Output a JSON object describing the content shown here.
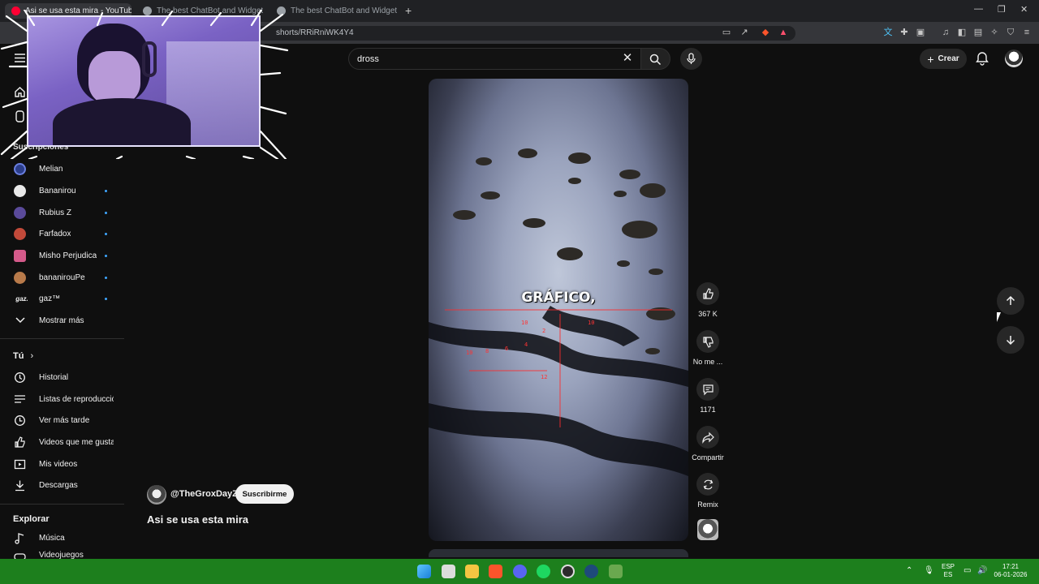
{
  "browser": {
    "tabs": [
      {
        "label": "Asi se usa esta mira - YouTube",
        "favicon_color": "#ff0033"
      },
      {
        "label": "The best ChatBot and Widgets for K",
        "favicon_color": "#9aa0a6"
      },
      {
        "label": "The best ChatBot and Widgets for Ki",
        "favicon_color": "#9aa0a6"
      }
    ],
    "new_tab_label": "+",
    "url": "shorts/RRiRniWK4Y4"
  },
  "header": {
    "search_value": "dross",
    "create_label": "Crear"
  },
  "sidebar": {
    "subscriptions_heading": "Suscripciones",
    "subscriptions": [
      {
        "label": "Melian",
        "color": "#2c3e8a",
        "live": false
      },
      {
        "label": "Bananirou",
        "color": "#e8e8e8",
        "live": true
      },
      {
        "label": "Rubius Z",
        "color": "#5a4a9a",
        "live": true
      },
      {
        "label": "Farfadox",
        "color": "#c24a3a",
        "live": true
      },
      {
        "label": "Misho Perjudica",
        "color": "#d45a8a",
        "live": true
      },
      {
        "label": "bananirouPe",
        "color": "#b87a4a",
        "live": true
      },
      {
        "label": "gaz™",
        "color": "#0f0f0f",
        "live": true,
        "text_logo": "gaz."
      }
    ],
    "show_more": "Mostrar más",
    "you_heading": "Tú",
    "you_items": [
      {
        "label": "Historial",
        "icon": "history-icon"
      },
      {
        "label": "Listas de reproducción",
        "icon": "playlists-icon"
      },
      {
        "label": "Ver más tarde",
        "icon": "clock-icon"
      },
      {
        "label": "Videos que me gustan",
        "icon": "thumbs-up-icon"
      },
      {
        "label": "Mis videos",
        "icon": "play-icon"
      },
      {
        "label": "Descargas",
        "icon": "download-icon"
      }
    ],
    "explore_heading": "Explorar",
    "explore_items": [
      {
        "label": "Música",
        "icon": "music-icon"
      },
      {
        "label": "Videojuegos",
        "icon": "gamepad-icon"
      }
    ]
  },
  "short": {
    "overlay_text": "GRÁFICO,",
    "channel": "@TheGroxDayZ",
    "subscribe_label": "Suscribirme",
    "title": "Asi se usa esta mira",
    "actions": {
      "likes": "367 K",
      "dislike": "No me ...",
      "comments": "1171",
      "share": "Compartir",
      "remix": "Remix"
    }
  },
  "taskbar": {
    "language_top": "ESP",
    "language_bottom": "ES",
    "time": "17:21",
    "date": "06-01-2026"
  }
}
